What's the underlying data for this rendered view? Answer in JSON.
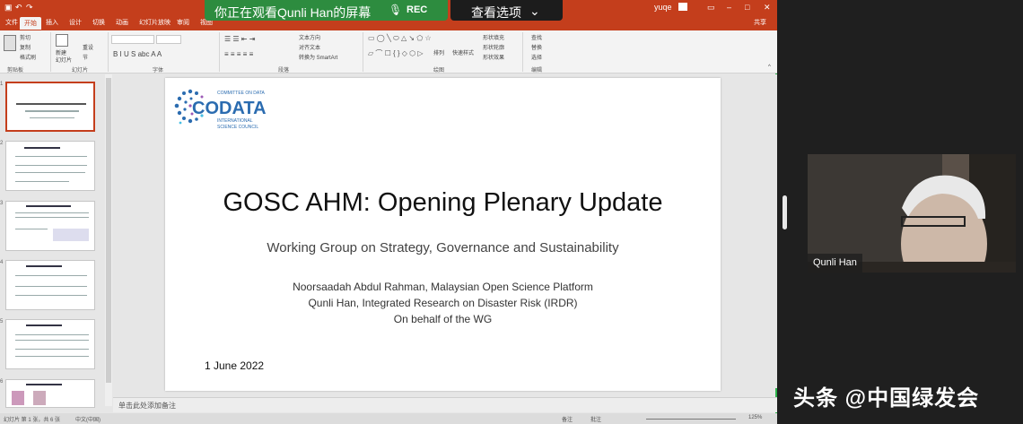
{
  "app": {
    "user": "yuqe",
    "share_label": "共享",
    "tabs": [
      "文件",
      "开始",
      "插入",
      "设计",
      "切换",
      "动画",
      "幻灯片放映",
      "审阅",
      "视图"
    ],
    "ribbon_groups": [
      "剪贴板",
      "幻灯片",
      "字体",
      "段落",
      "绘图",
      "编辑"
    ],
    "ribbon_items": [
      "剪切",
      "复制",
      "格式刷",
      "新建",
      "幻灯片",
      "重设",
      "节",
      "文本方向",
      "对齐文本",
      "转换为 SmartArt",
      "排列",
      "快速样式",
      "形状填充",
      "形状轮廓",
      "形状效果",
      "查找",
      "替换",
      "选择"
    ]
  },
  "zoom": {
    "share_text": "你正在观看Qunli Han的屏幕",
    "rec": "REC",
    "view_options": "查看选项",
    "participant_name": "Qunli Han",
    "watermark": "头条 @中国绿发会"
  },
  "slide": {
    "logo_top": "COMMITTEE ON DATA",
    "logo_main": "CODATA",
    "logo_bottom1": "INTERNATIONAL",
    "logo_bottom2": "SCIENCE COUNCIL",
    "title": "GOSC AHM: Opening Plenary Update",
    "subtitle": "Working Group on Strategy, Governance and Sustainability",
    "author1": "Noorsaadah Abdul Rahman, Malaysian Open Science Platform",
    "author2": "Qunli Han, Integrated Research on Disaster Risk (IRDR)",
    "author3": "On behalf of the WG",
    "date": "1 June 2022"
  },
  "notes_placeholder": "单击此处添加备注",
  "status": {
    "slide_info": "幻灯片 第 1 张，共 6 张",
    "lang": "中文(中国)",
    "notes": "备注",
    "comments": "批注",
    "zoom": "125%"
  },
  "colors": {
    "ppt_red": "#c43e1c",
    "zoom_green": "#2d8c3f",
    "codata_blue": "#2b6cb0"
  }
}
